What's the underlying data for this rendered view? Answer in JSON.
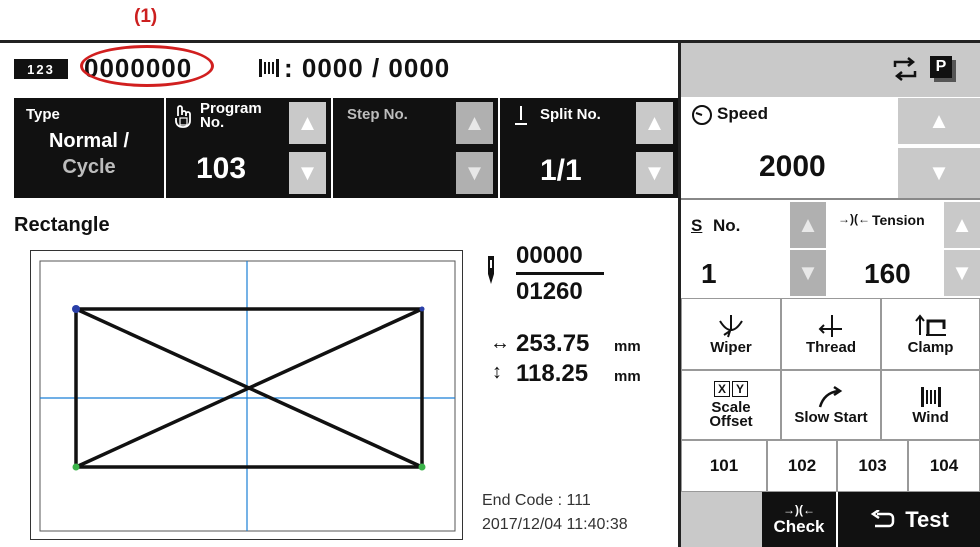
{
  "callout": {
    "label": "(1)"
  },
  "topbar": {
    "count_icon_text": "123",
    "count_value": "0000000",
    "wind_value": ": 0000 / 0000",
    "p_icon_text": "P"
  },
  "type_panel": {
    "label": "Type",
    "value_line1": "Normal /",
    "value_line2": "Cycle"
  },
  "program_panel": {
    "label_line1": "Program",
    "label_line2": "No.",
    "value": "103"
  },
  "step_panel": {
    "label": "Step No."
  },
  "split_panel": {
    "label": "Split No.",
    "value": "1/1"
  },
  "speed_panel": {
    "label": "Speed",
    "value": "2000"
  },
  "s_panel": {
    "label": "No.",
    "value": "1",
    "s_glyph": "S"
  },
  "tension_panel": {
    "label": "Tension",
    "value": "160"
  },
  "pattern": {
    "name": "Rectangle",
    "stitch_current": "00000",
    "stitch_total": "01260",
    "width_value": "253.75",
    "height_value": "118.25",
    "unit": "mm",
    "end_code": "End Code : 111",
    "timestamp": "2017/12/04 11:40:38"
  },
  "functions": {
    "wiper": "Wiper",
    "thread": "Thread",
    "clamp": "Clamp",
    "scale_line1": "Scale",
    "scale_line2": "Offset",
    "slow_start": "Slow Start",
    "wind": "Wind",
    "xy_x": "X",
    "xy_y": "Y"
  },
  "program_shortcuts": [
    "101",
    "102",
    "103",
    "104"
  ],
  "bottom": {
    "check_label": "Check",
    "test_label": "Test"
  },
  "colors": {
    "callout": "#d11f1f",
    "panel_black": "#111111",
    "panel_gray": "#c9c9c9",
    "guide_blue": "#1a7fd6"
  }
}
